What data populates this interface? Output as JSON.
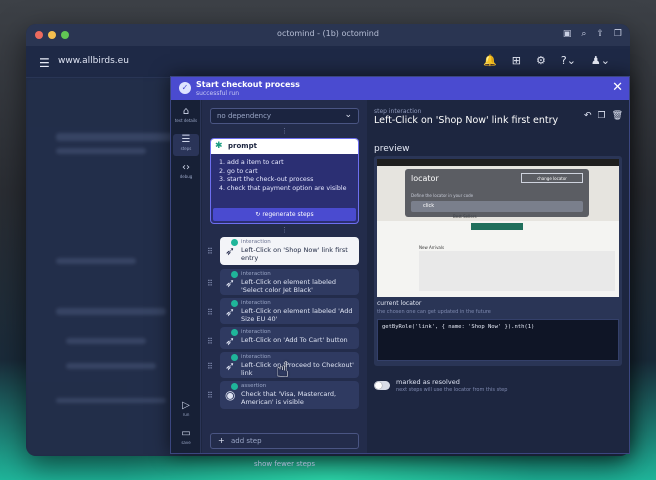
{
  "window": {
    "title": "octomind - (1b) octomind",
    "url": "www.allbirds.eu"
  },
  "icons": {
    "toolbar": [
      "sidebar-icon",
      "search-icon",
      "share-icon",
      "tabs-icon"
    ],
    "appbar": [
      "bell-icon",
      "gift-icon",
      "gear-icon",
      "help-icon",
      "user-icon"
    ]
  },
  "panel": {
    "title": "Start checkout process",
    "subtitle": "successful run",
    "nav": [
      {
        "label": "test details",
        "icon": "home-icon"
      },
      {
        "label": "steps",
        "icon": "steps-icon"
      },
      {
        "label": "debug",
        "icon": "code-icon"
      },
      {
        "label": "run",
        "icon": "play-icon"
      },
      {
        "label": "save",
        "icon": "save-icon"
      }
    ]
  },
  "steps": {
    "dependency": "no dependency",
    "prompt_title": "prompt",
    "prompt_lines": [
      "1. add a item to cart",
      "2. go to cart",
      "3. start the check-out process",
      "4. check that payment option are visible"
    ],
    "regenerate_label": "regenerate steps",
    "items": [
      {
        "kind": "interaction",
        "text": "Left-Click on 'Shop Now' link first entry"
      },
      {
        "kind": "interaction",
        "text": "Left-Click on element labeled 'Select color Jet Black'"
      },
      {
        "kind": "interaction",
        "text": "Left-Click on element labeled 'Add Size EU 40'"
      },
      {
        "kind": "interaction",
        "text": "Left-Click on 'Add To Cart' button"
      },
      {
        "kind": "interaction",
        "text": "Left-Click on 'Proceed to Checkout' link"
      },
      {
        "kind": "assertion",
        "text": "Check that 'Visa, Mastercard, American' is visible"
      }
    ],
    "add_step": "add step",
    "show_fewer": "show fewer steps"
  },
  "detail": {
    "kind": "step interaction",
    "title": "Left-Click on 'Shop Now' link first entry",
    "preview_label": "preview",
    "locator": {
      "title": "locator",
      "placeholder": "Define the locator in your code",
      "button": "change locator",
      "selected": "click"
    },
    "preview_page": {
      "heading": "Best Sellers",
      "section": "New Arrivals"
    },
    "current_locator_label": "current locator",
    "current_locator_hint": "the chosen one can get updated in the future",
    "code": "getByRole('link', { name: 'Shop Now' }).nth(1)",
    "option_label": "marked as resolved",
    "option_desc": "next steps will use the locator from this step"
  }
}
